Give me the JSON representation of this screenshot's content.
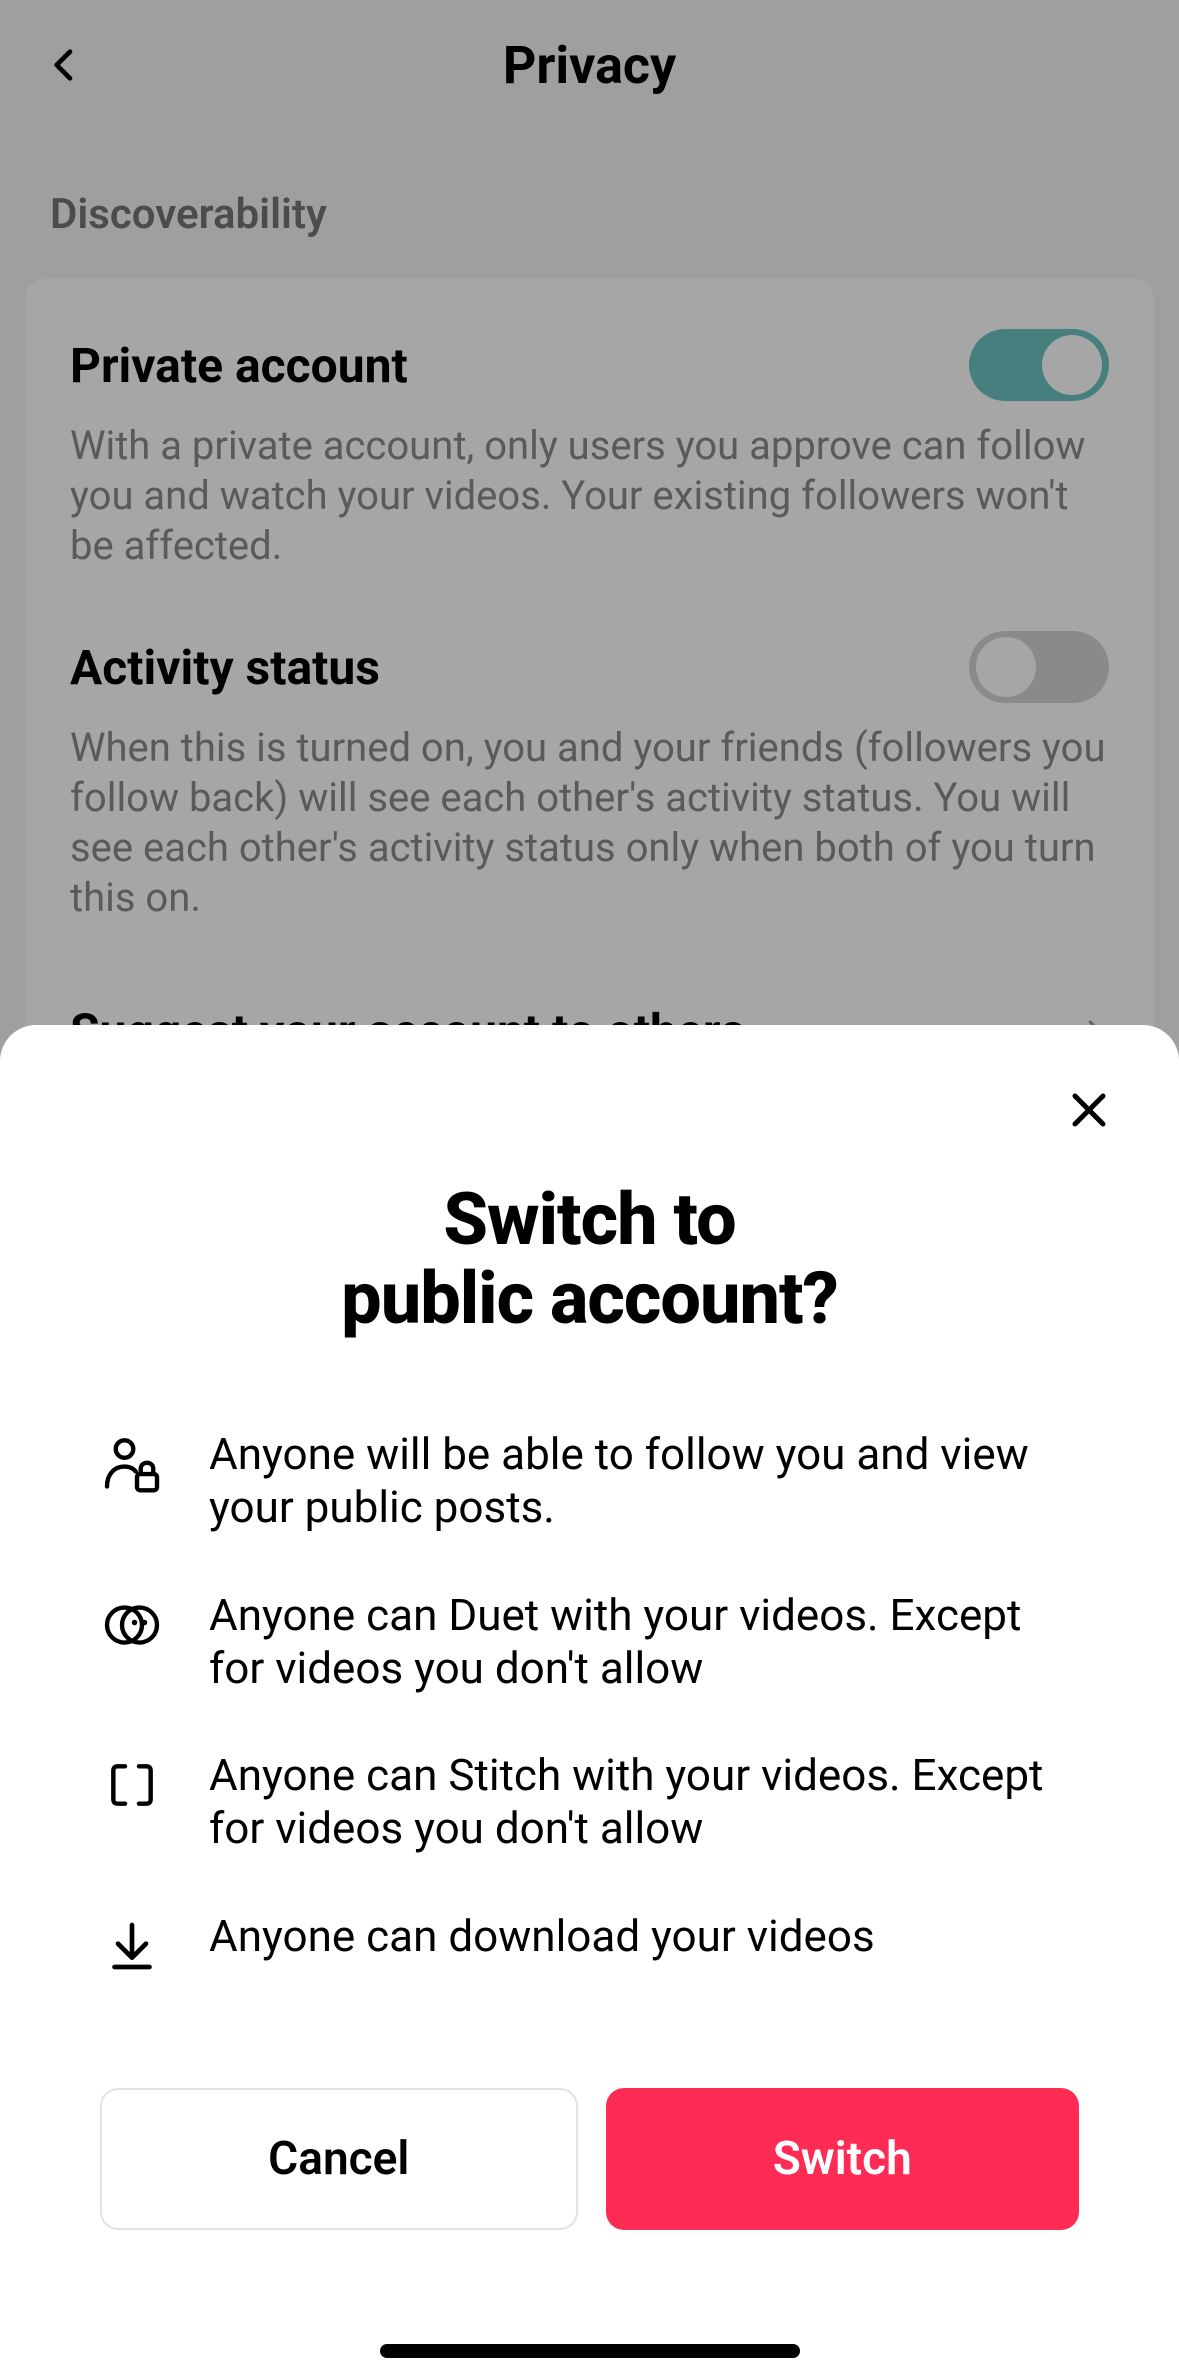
{
  "header": {
    "title": "Privacy"
  },
  "section": {
    "label": "Discoverability"
  },
  "settings": {
    "private": {
      "title": "Private account",
      "desc": "With a private account, only users you approve can follow you and watch your videos. Your existing followers won't be affected."
    },
    "activity": {
      "title": "Activity status",
      "desc": "When this is turned on, you and your friends (followers you follow back) will see each other's activity status. You will see each other's activity status only when both of you turn this on."
    },
    "suggest": {
      "title": "Suggest your account to others"
    }
  },
  "sheet": {
    "title_line1": "Switch to",
    "title_line2": "public account?",
    "items": [
      "Anyone will be able to follow you and view your public posts.",
      "Anyone can Duet with your videos. Except for videos you don't allow",
      "Anyone can Stitch with your videos. Except for videos you don't allow",
      "Anyone can download your videos"
    ],
    "cancel": "Cancel",
    "switch": "Switch"
  }
}
